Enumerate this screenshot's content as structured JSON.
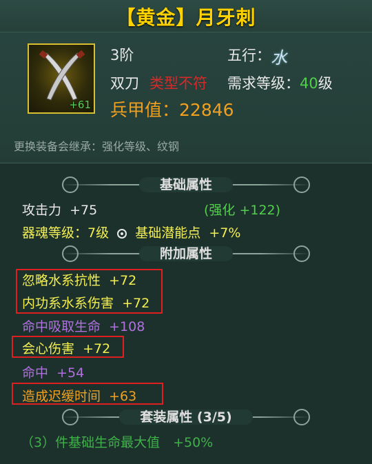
{
  "header": {
    "title": "【黄金】月牙刺"
  },
  "item": {
    "enhance_level": "+61",
    "icon": "crossed-sabers-icon",
    "grade": "3阶",
    "element_label": "五行：",
    "element_value": "水",
    "weapon_type": "双刀",
    "type_mismatch": "类型不符",
    "req_level_label": "需求等级：",
    "req_level_value": "40",
    "req_level_unit": "级",
    "power_label": "兵甲值：",
    "power_value": "22846",
    "inherit_note": "更换装备会继承：强化等级、纹钢"
  },
  "base_section": {
    "title": "基础属性",
    "attack_label": "攻击力",
    "attack_value": "+75",
    "enhance_bonus": "(强化 +122)",
    "soul_level": "器魂等级：7级",
    "potential_label": "基础潜能点",
    "potential_value": "+7%"
  },
  "extra_section": {
    "title": "附加属性",
    "attrs": [
      {
        "label": "忽略水系抗性",
        "value": "+72"
      },
      {
        "label": "内功系水系伤害",
        "value": "+72"
      },
      {
        "label": "命中吸取生命",
        "value": "+108"
      },
      {
        "label": "会心伤害",
        "value": "+72"
      },
      {
        "label": "命中",
        "value": "+54"
      },
      {
        "label": "造成迟缓时间",
        "value": "+63"
      }
    ]
  },
  "set_section": {
    "title": "套装属性 (3/5)",
    "bonus": "（3）件基础生命最大值　+50%"
  },
  "colors": {
    "title": "#ffd200",
    "highlight_box": "#e02020",
    "green": "#50d04a",
    "purple": "#b070e0",
    "yellow": "#f4ef50",
    "mismatch": "#d42a2a"
  }
}
